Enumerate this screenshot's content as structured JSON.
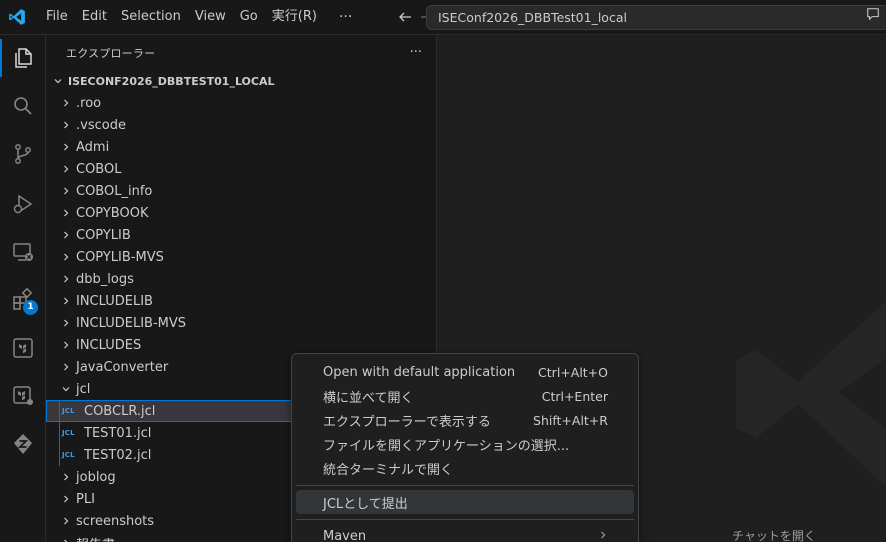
{
  "titlebar": {
    "menus": [
      "File",
      "Edit",
      "Selection",
      "View",
      "Go",
      "実行(R)"
    ],
    "more": "···",
    "search_text": "ISEConf2026_DBBTest01_local"
  },
  "activity_bar": {
    "items": [
      "explorer-icon",
      "search-icon",
      "source-control-icon",
      "run-debug-icon",
      "remote-explorer-icon",
      "extensions-icon",
      "terraform-icon",
      "terraform-cloud-icon",
      "zowe-icon"
    ],
    "extensions_badge": "1"
  },
  "sidebar": {
    "title": "エクスプローラー",
    "more": "···",
    "root": "ISECONF2026_DBBTEST01_LOCAL",
    "tree": [
      {
        "label": ".roo",
        "type": "folder"
      },
      {
        "label": ".vscode",
        "type": "folder"
      },
      {
        "label": "Admi",
        "type": "folder"
      },
      {
        "label": "COBOL",
        "type": "folder"
      },
      {
        "label": "COBOL_info",
        "type": "folder"
      },
      {
        "label": "COPYBOOK",
        "type": "folder"
      },
      {
        "label": "COPYLIB",
        "type": "folder"
      },
      {
        "label": "COPYLIB-MVS",
        "type": "folder"
      },
      {
        "label": "dbb_logs",
        "type": "folder"
      },
      {
        "label": "INCLUDELIB",
        "type": "folder"
      },
      {
        "label": "INCLUDELIB-MVS",
        "type": "folder"
      },
      {
        "label": "INCLUDES",
        "type": "folder"
      },
      {
        "label": "JavaConverter",
        "type": "folder"
      },
      {
        "label": "jcl",
        "type": "folder-open"
      },
      {
        "label": "COBCLR.jcl",
        "type": "file"
      },
      {
        "label": "TEST01.jcl",
        "type": "file"
      },
      {
        "label": "TEST02.jcl",
        "type": "file"
      },
      {
        "label": "joblog",
        "type": "folder"
      },
      {
        "label": "PLI",
        "type": "folder"
      },
      {
        "label": "screenshots",
        "type": "folder"
      },
      {
        "label": "報告書",
        "type": "folder"
      }
    ],
    "file_icon_text": "JCL"
  },
  "editor": {
    "hint": "チャットを開く"
  },
  "context_menu": {
    "items": [
      {
        "label": "Open with default application",
        "shortcut": "Ctrl+Alt+O"
      },
      {
        "label": "横に並べて開く",
        "shortcut": "Ctrl+Enter"
      },
      {
        "label": "エクスプローラーで表示する",
        "shortcut": "Shift+Alt+R"
      },
      {
        "label": "ファイルを開くアプリケーションの選択...",
        "shortcut": ""
      },
      {
        "label": "統合ターミナルで開く",
        "shortcut": ""
      }
    ],
    "submit": "JCLとして提出",
    "maven": "Maven"
  },
  "colors": {
    "accent": "#0078d4",
    "vscode_logo": "#23a9f2",
    "jcl_icon": "#3b9ee6"
  }
}
